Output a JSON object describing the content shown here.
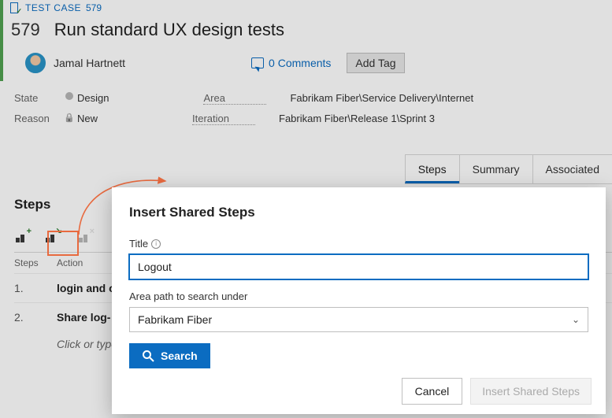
{
  "header": {
    "type_label": "TEST CASE",
    "id": "579",
    "title": "Run standard UX design tests",
    "assignee": "Jamal Hartnett",
    "comments_count": "0 Comments",
    "add_tag_label": "Add Tag"
  },
  "fields": {
    "state_label": "State",
    "state_value": "Design",
    "reason_label": "Reason",
    "reason_value": "New",
    "area_label": "Area",
    "area_value": "Fabrikam Fiber\\Service Delivery\\Internet",
    "iteration_label": "Iteration",
    "iteration_value": "Fabrikam Fiber\\Release 1\\Sprint 3"
  },
  "tabs": {
    "steps": "Steps",
    "summary": "Summary",
    "associated": "Associated"
  },
  "steps": {
    "heading": "Steps",
    "col_steps": "Steps",
    "col_action": "Action",
    "rows": [
      {
        "num": "1.",
        "action": "login and o"
      },
      {
        "num": "2.",
        "action": "Share log-"
      }
    ],
    "placeholder": "Click or type"
  },
  "dialog": {
    "title": "Insert Shared Steps",
    "title_label": "Title",
    "title_value": "Logout",
    "area_label": "Area path to search under",
    "area_value": "Fabrikam Fiber",
    "search_label": "Search",
    "cancel_label": "Cancel",
    "insert_label": "Insert Shared Steps"
  }
}
